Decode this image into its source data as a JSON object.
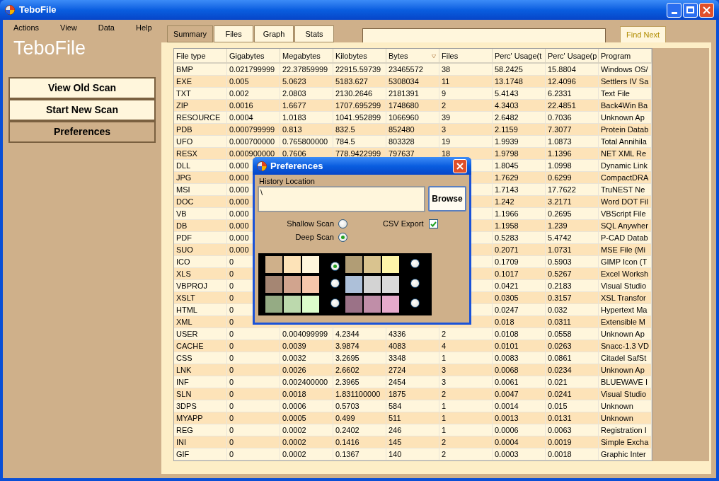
{
  "window": {
    "title": "TeboFile"
  },
  "menu": [
    "Actions",
    "View",
    "Data",
    "Help"
  ],
  "app_title": "TeboFile",
  "nav": [
    {
      "label": "View Old Scan",
      "selected": false
    },
    {
      "label": "Start New Scan",
      "selected": false
    },
    {
      "label": "Preferences",
      "selected": true
    }
  ],
  "tabs": [
    {
      "label": "Summary",
      "selected": true
    },
    {
      "label": "Files",
      "selected": false
    },
    {
      "label": "Graph",
      "selected": false
    },
    {
      "label": "Stats",
      "selected": false
    }
  ],
  "find_button": "Find Next",
  "table": {
    "columns": [
      {
        "label": "File type",
        "sorted": false
      },
      {
        "label": "Gigabytes",
        "sorted": false
      },
      {
        "label": "Megabytes",
        "sorted": false
      },
      {
        "label": "Kilobytes",
        "sorted": false
      },
      {
        "label": "Bytes",
        "sorted": true
      },
      {
        "label": "Files",
        "sorted": false
      },
      {
        "label": "Perc' Usage(t",
        "sorted": false
      },
      {
        "label": "Perc' Usage(p",
        "sorted": false
      },
      {
        "label": "Program",
        "sorted": false
      }
    ],
    "rows": [
      [
        "BMP",
        "0.021799999",
        "22.37859999",
        "22915.59739",
        "23465572",
        "38",
        "58.2425",
        "15.8804",
        "Windows OS/"
      ],
      [
        "EXE",
        "0.005",
        "5.0623",
        "5183.627",
        "5308034",
        "11",
        "13.1748",
        "12.4096",
        "Settlers IV Sa"
      ],
      [
        "TXT",
        "0.002",
        "2.0803",
        "2130.2646",
        "2181391",
        "9",
        "5.4143",
        "6.2331",
        "Text File"
      ],
      [
        "ZIP",
        "0.0016",
        "1.6677",
        "1707.695299",
        "1748680",
        "2",
        "4.3403",
        "22.4851",
        "Back4Win Ba"
      ],
      [
        "RESOURCE",
        "0.0004",
        "1.0183",
        "1041.952899",
        "1066960",
        "39",
        "2.6482",
        "0.7036",
        "Unknown Ap"
      ],
      [
        "PDB",
        "0.000799999",
        "0.813",
        "832.5",
        "852480",
        "3",
        "2.1159",
        "7.3077",
        "Protein Datab"
      ],
      [
        "UFO",
        "0.000700000",
        "0.765800000",
        "784.5",
        "803328",
        "19",
        "1.9939",
        "1.0873",
        "Total Annihila"
      ],
      [
        "RESX",
        "0.000900000",
        "0.7606",
        "778.9422999",
        "797637",
        "18",
        "1.9798",
        "1.1396",
        "NET XML Re"
      ],
      [
        "DLL",
        "0.000",
        null,
        null,
        null,
        null,
        "1.8045",
        "1.0998",
        "Dynamic Link"
      ],
      [
        "JPG",
        "0.000",
        null,
        null,
        null,
        null,
        "1.7629",
        "0.6299",
        "CompactDRA"
      ],
      [
        "MSI",
        "0.000",
        null,
        null,
        null,
        null,
        "1.7143",
        "17.7622",
        "TruNEST Ne"
      ],
      [
        "DOC",
        "0.000",
        null,
        null,
        null,
        null,
        "1.242",
        "3.2171",
        "Word DOT Fil"
      ],
      [
        "VB",
        "0.000",
        null,
        null,
        null,
        null,
        "1.1966",
        "0.2695",
        "VBScript File"
      ],
      [
        "DB",
        "0.000",
        null,
        null,
        null,
        null,
        "1.1958",
        "1.239",
        "SQL Anywher"
      ],
      [
        "PDF",
        "0.000",
        null,
        null,
        null,
        null,
        "0.5283",
        "5.4742",
        "P-CAD Datab"
      ],
      [
        "SUO",
        "0.000",
        null,
        null,
        null,
        null,
        "0.2071",
        "1.0731",
        "MSE File (Mi"
      ],
      [
        "ICO",
        "0",
        null,
        null,
        null,
        null,
        "0.1709",
        "0.5903",
        "GIMP Icon (T"
      ],
      [
        "XLS",
        "0",
        null,
        null,
        null,
        null,
        "0.1017",
        "0.5267",
        "Excel Worksh"
      ],
      [
        "VBPROJ",
        "0",
        null,
        null,
        null,
        null,
        "0.0421",
        "0.2183",
        "Visual Studio"
      ],
      [
        "XSLT",
        "0",
        null,
        null,
        null,
        null,
        "0.0305",
        "0.3157",
        "XSL Transfor"
      ],
      [
        "HTML",
        "0",
        null,
        null,
        null,
        null,
        "0.0247",
        "0.032",
        "Hypertext Ma"
      ],
      [
        "XML",
        "0",
        null,
        null,
        null,
        null,
        "0.018",
        "0.0311",
        "Extensible M"
      ],
      [
        "USER",
        "0",
        "0.004099999",
        "4.2344",
        "4336",
        "2",
        "0.0108",
        "0.0558",
        "Unknown Ap"
      ],
      [
        "CACHE",
        "0",
        "0.0039",
        "3.9874",
        "4083",
        "4",
        "0.0101",
        "0.0263",
        "Snacc-1.3 VD"
      ],
      [
        "CSS",
        "0",
        "0.0032",
        "3.2695",
        "3348",
        "1",
        "0.0083",
        "0.0861",
        "Citadel SafSt"
      ],
      [
        "LNK",
        "0",
        "0.0026",
        "2.6602",
        "2724",
        "3",
        "0.0068",
        "0.0234",
        "Unknown Ap"
      ],
      [
        "INF",
        "0",
        "0.002400000",
        "2.3965",
        "2454",
        "3",
        "0.0061",
        "0.021",
        "BLUEWAVE I"
      ],
      [
        "SLN",
        "0",
        "0.0018",
        "1.831100000",
        "1875",
        "2",
        "0.0047",
        "0.0241",
        "Visual Studio"
      ],
      [
        "3DPS",
        "0",
        "0.0006",
        "0.5703",
        "584",
        "1",
        "0.0014",
        "0.015",
        "Unknown"
      ],
      [
        "MYAPP",
        "0",
        "0.0005",
        "0.499",
        "511",
        "1",
        "0.0013",
        "0.0131",
        "Unknown"
      ],
      [
        "REG",
        "0",
        "0.0002",
        "0.2402",
        "246",
        "1",
        "0.0006",
        "0.0063",
        "Registration I"
      ],
      [
        "INI",
        "0",
        "0.0002",
        "0.1416",
        "145",
        "2",
        "0.0004",
        "0.0019",
        "Simple Excha"
      ],
      [
        "GIF",
        "0",
        "0.0002",
        "0.1367",
        "140",
        "2",
        "0.0003",
        "0.0018",
        "Graphic Inter"
      ]
    ]
  },
  "dialog": {
    "title": "Preferences",
    "history_label": "History Location",
    "history_value": "\\",
    "browse_button": "Browse",
    "scan_options": [
      {
        "label": "Shallow Scan",
        "selected": false
      },
      {
        "label": "Deep Scan",
        "selected": true
      }
    ],
    "csv_export": {
      "label": "CSV Export",
      "checked": true
    },
    "themes": [
      {
        "swatches": [
          {
            "color": "#cfb08a"
          },
          {
            "color": "#fde3b8"
          },
          {
            "color": "#fff6dc"
          }
        ],
        "selected": true
      },
      {
        "swatches": [
          {
            "color": "#b19d75"
          },
          {
            "color": "#d9c38f"
          },
          {
            "color": "#fef5a8"
          }
        ],
        "selected": false
      },
      {
        "swatches": [
          {
            "color": "#a58673"
          },
          {
            "color": "#d1a48e"
          },
          {
            "color": "#f5c6ab"
          }
        ],
        "selected": false
      },
      {
        "swatches": [
          {
            "color": "#adc0d9"
          },
          {
            "color": "#d3d3d3"
          },
          {
            "color": "#dadada"
          }
        ],
        "selected": false
      },
      {
        "swatches": [
          {
            "color": "#95ab84"
          },
          {
            "color": "#bcd9ad"
          },
          {
            "color": "#dcfdcb"
          }
        ],
        "selected": false
      },
      {
        "swatches": [
          {
            "color": "#9b7287"
          },
          {
            "color": "#c08ea8"
          },
          {
            "color": "#e6aacb"
          }
        ],
        "selected": false
      }
    ]
  }
}
